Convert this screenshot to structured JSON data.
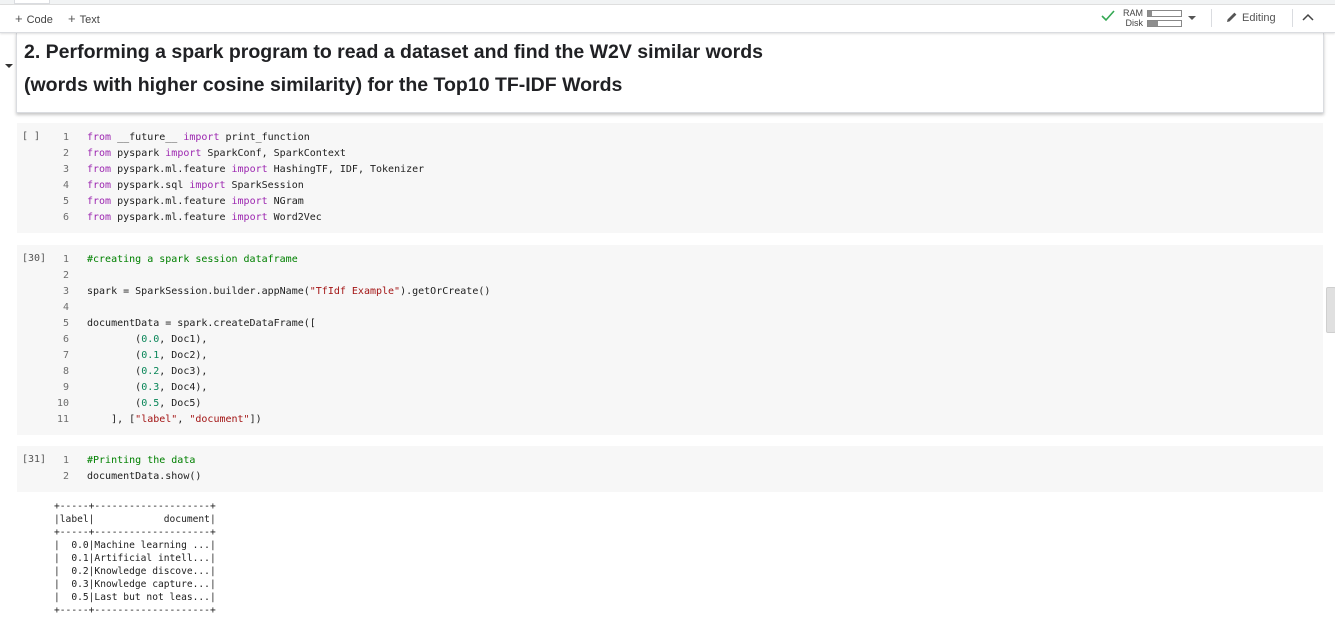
{
  "toolbar": {
    "add_code": "Code",
    "add_text": "Text",
    "ram_label": "RAM",
    "disk_label": "Disk",
    "ram_usage": 0.12,
    "disk_usage": 0.3,
    "editing_label": "Editing"
  },
  "heading": {
    "line1": "2. Performing a spark program to read a dataset and find the W2V similar words",
    "line2": "(words with higher cosine similarity) for the Top10 TF-IDF Words"
  },
  "cells": [
    {
      "exec": "[ ]",
      "lines": [
        {
          "n": "1",
          "tokens": [
            {
              "t": "kw",
              "v": "from"
            },
            {
              "t": "",
              "v": " __future__ "
            },
            {
              "t": "kw",
              "v": "import"
            },
            {
              "t": "",
              "v": " print_function"
            }
          ]
        },
        {
          "n": "2",
          "tokens": [
            {
              "t": "kw",
              "v": "from"
            },
            {
              "t": "",
              "v": " pyspark "
            },
            {
              "t": "kw",
              "v": "import"
            },
            {
              "t": "",
              "v": " SparkConf, SparkContext"
            }
          ]
        },
        {
          "n": "3",
          "tokens": [
            {
              "t": "kw",
              "v": "from"
            },
            {
              "t": "",
              "v": " pyspark.ml.feature "
            },
            {
              "t": "kw",
              "v": "import"
            },
            {
              "t": "",
              "v": " HashingTF, IDF, Tokenizer"
            }
          ]
        },
        {
          "n": "4",
          "tokens": [
            {
              "t": "kw",
              "v": "from"
            },
            {
              "t": "",
              "v": " pyspark.sql "
            },
            {
              "t": "kw",
              "v": "import"
            },
            {
              "t": "",
              "v": " SparkSession"
            }
          ]
        },
        {
          "n": "5",
          "tokens": [
            {
              "t": "kw",
              "v": "from"
            },
            {
              "t": "",
              "v": " pyspark.ml.feature "
            },
            {
              "t": "kw",
              "v": "import"
            },
            {
              "t": "",
              "v": " NGram"
            }
          ]
        },
        {
          "n": "6",
          "tokens": [
            {
              "t": "kw",
              "v": "from"
            },
            {
              "t": "",
              "v": " pyspark.ml.feature "
            },
            {
              "t": "kw",
              "v": "import"
            },
            {
              "t": "",
              "v": " Word2Vec"
            }
          ]
        }
      ]
    },
    {
      "exec": "[30]",
      "lines": [
        {
          "n": "1",
          "tokens": [
            {
              "t": "cmt",
              "v": "#creating a spark session dataframe"
            }
          ]
        },
        {
          "n": "2",
          "tokens": []
        },
        {
          "n": "3",
          "tokens": [
            {
              "t": "",
              "v": "spark = SparkSession.builder.appName("
            },
            {
              "t": "str",
              "v": "\"TfIdf Example\""
            },
            {
              "t": "",
              "v": ").getOrCreate()"
            }
          ]
        },
        {
          "n": "4",
          "tokens": []
        },
        {
          "n": "5",
          "tokens": [
            {
              "t": "",
              "v": "documentData = spark.createDataFrame(["
            }
          ]
        },
        {
          "n": "6",
          "tokens": [
            {
              "t": "",
              "v": "        ("
            },
            {
              "t": "num",
              "v": "0.0"
            },
            {
              "t": "",
              "v": ", Doc1),"
            }
          ]
        },
        {
          "n": "7",
          "tokens": [
            {
              "t": "",
              "v": "        ("
            },
            {
              "t": "num",
              "v": "0.1"
            },
            {
              "t": "",
              "v": ", Doc2),"
            }
          ]
        },
        {
          "n": "8",
          "tokens": [
            {
              "t": "",
              "v": "        ("
            },
            {
              "t": "num",
              "v": "0.2"
            },
            {
              "t": "",
              "v": ", Doc3),"
            }
          ]
        },
        {
          "n": "9",
          "tokens": [
            {
              "t": "",
              "v": "        ("
            },
            {
              "t": "num",
              "v": "0.3"
            },
            {
              "t": "",
              "v": ", Doc4),"
            }
          ]
        },
        {
          "n": "10",
          "tokens": [
            {
              "t": "",
              "v": "        ("
            },
            {
              "t": "num",
              "v": "0.5"
            },
            {
              "t": "",
              "v": ", Doc5)"
            }
          ]
        },
        {
          "n": "11",
          "tokens": [
            {
              "t": "",
              "v": "    ], ["
            },
            {
              "t": "str",
              "v": "\"label\""
            },
            {
              "t": "",
              "v": ", "
            },
            {
              "t": "str",
              "v": "\"document\""
            },
            {
              "t": "",
              "v": "])"
            }
          ]
        }
      ]
    },
    {
      "exec": "[31]",
      "lines": [
        {
          "n": "1",
          "tokens": [
            {
              "t": "cmt",
              "v": "#Printing the data"
            }
          ]
        },
        {
          "n": "2",
          "tokens": [
            {
              "t": "",
              "v": "documentData.show()"
            }
          ]
        }
      ]
    }
  ],
  "output_text": "+-----+--------------------+\n|label|            document|\n+-----+--------------------+\n|  0.0|Machine learning ...|\n|  0.1|Artificial intell...|\n|  0.2|Knowledge discove...|\n|  0.3|Knowledge capture...|\n|  0.5|Last but not leas...|\n+-----+--------------------+"
}
